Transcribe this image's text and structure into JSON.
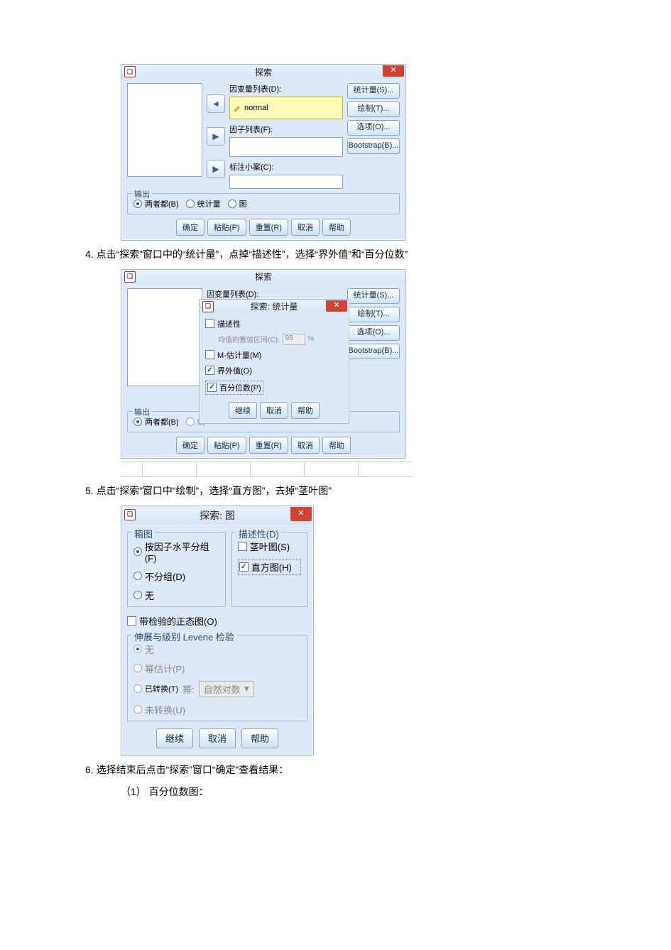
{
  "steps": {
    "s4": "4. 点击“探索”窗口中的“统计量”，点掉“描述性”，选择“界外值”和“百分位数”",
    "s5": "5. 点击“探索”窗口中“绘制”，选择“直方图”，去掉“茎叶图”",
    "s6": "6. 选择结束后点击“探索”窗口“确定”查看结果：",
    "s6_1": "（1） 百分位数图："
  },
  "explore1": {
    "title": "探索",
    "labels": {
      "depvar": "因变量列表(D):",
      "factor": "因子列表(F):",
      "caselabel": "标注小案(C):",
      "output_group": "输出"
    },
    "depvar_item": "normal",
    "side_buttons": [
      "统计量(S)...",
      "绘制(T)...",
      "选项(O)...",
      "Bootstrap(B)..."
    ],
    "radios": {
      "both": "两者都(B)",
      "stat": "统计量",
      "plot": "图"
    },
    "bottom": {
      "ok": "确定",
      "paste": "粘贴(P)",
      "reset": "重置(R)",
      "cancel": "取消",
      "help": "帮助"
    }
  },
  "explore2": {
    "title": "探索",
    "subdialog_title": "探索: 统计量",
    "labels": {
      "depvar": "因变量列表(D):",
      "output_group": "输出"
    },
    "side_buttons": [
      "统计量(S)...",
      "绘制(T)...",
      "选项(O)...",
      "Bootstrap(B)..."
    ],
    "checks": {
      "desc": "描述性",
      "ci_label": "均值的置信区间(C):",
      "ci_value": "95",
      "ci_pct": "%",
      "mest": "M-估计量(M)",
      "outlier": "界外值(O)",
      "percentile": "百分位数(P)"
    },
    "radios_both": "两者都(B)",
    "sub_bottom": {
      "cont": "继续",
      "cancel": "取消",
      "help": "帮助"
    },
    "bottom": {
      "ok": "确定",
      "paste": "粘贴(P)",
      "reset": "重置(R)",
      "cancel": "取消",
      "help": "帮助"
    }
  },
  "plots": {
    "title": "探索: 图",
    "box_group": "箱图",
    "box_r1": "按因子水平分组(F)",
    "box_r2": "不分组(D)",
    "box_r3": "无",
    "desc_group": "描述性(D)",
    "stemleaf": "茎叶图(S)",
    "hist": "直方图(H)",
    "normality": "带检验的正态图(O)",
    "levene_group": "伸展与级别 Levene 检验",
    "lv_none": "无",
    "lv_power": "幂估计(P)",
    "lv_trans": "已转换(T)",
    "lv_power_label": "幂:",
    "lv_power_val": "自然对数",
    "lv_untrans": "未转换(U)",
    "bottom": {
      "cont": "继续",
      "cancel": "取消",
      "help": "帮助"
    }
  }
}
